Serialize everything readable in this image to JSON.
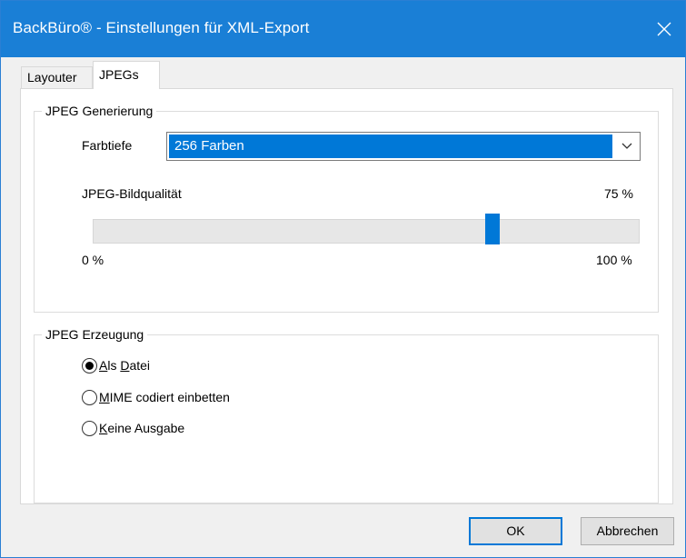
{
  "window": {
    "title": "BackBüro® - Einstellungen für XML-Export",
    "close_icon": "close-icon"
  },
  "tabs": [
    {
      "label": "Layouter",
      "active": false
    },
    {
      "label": "JPEGs",
      "active": true
    }
  ],
  "jpeg_generierung": {
    "legend": "JPEG Generierung",
    "farbtiefe_label": "Farbtiefe",
    "farbtiefe_value": "256 Farben",
    "quality_label": "JPEG-Bildqualität",
    "quality_value_text": "75 %",
    "quality_value": 75,
    "min_label": "0 %",
    "max_label": "100 %"
  },
  "jpeg_erzeugung": {
    "legend": "JPEG Erzeugung",
    "options": [
      {
        "mnemonic": "A",
        "rest": "ls ",
        "mnemonic2": "D",
        "rest2": "atei",
        "selected": true
      },
      {
        "mnemonic": "M",
        "rest": "IME codiert einbetten",
        "selected": false
      },
      {
        "mnemonic": "K",
        "rest": "eine Ausgabe",
        "selected": false
      }
    ]
  },
  "buttons": {
    "ok": "OK",
    "cancel": "Abbrechen"
  },
  "colors": {
    "titlebar": "#1a7fd6",
    "accent": "#0078d7"
  }
}
